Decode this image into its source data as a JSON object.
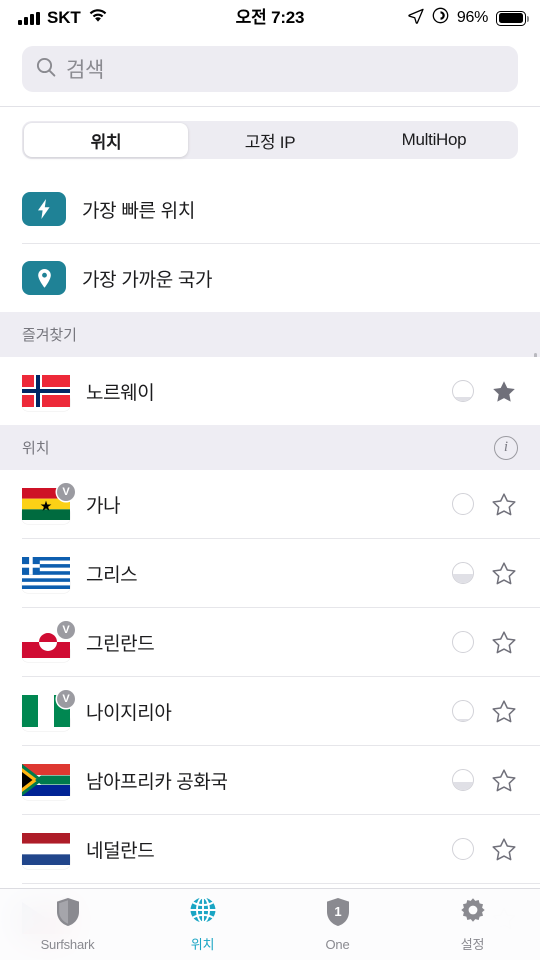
{
  "statusbar": {
    "carrier": "SKT",
    "time": "오전 7:23",
    "battery_percent": "96%",
    "signal_icon": "cellular-bars-icon",
    "wifi_icon": "wifi-icon",
    "location_icon": "location-arrow-icon",
    "vpn_icon": "vpn-badge-icon",
    "battery_icon": "battery-full-icon"
  },
  "search": {
    "placeholder": "검색",
    "icon": "search-icon",
    "value": ""
  },
  "segmented": {
    "options": [
      {
        "label": "위치",
        "selected": true
      },
      {
        "label": "고정 IP",
        "selected": false
      },
      {
        "label": "MultiHop",
        "selected": false
      }
    ]
  },
  "quick_actions": [
    {
      "label": "가장 빠른 위치",
      "icon": "lightning-bolt-icon",
      "color": "#1f8296"
    },
    {
      "label": "가장 가까운 국가",
      "icon": "map-pin-icon",
      "color": "#1f8296"
    }
  ],
  "favorites": {
    "header": "즐겨찾기",
    "items": [
      {
        "name": "노르웨이",
        "flag": "no",
        "virtual": false,
        "favorite": true,
        "load": 22
      }
    ]
  },
  "locations": {
    "header": "위치",
    "info_icon": "info-circle-icon",
    "items": [
      {
        "name": "가나",
        "flag": "gh",
        "virtual": true,
        "favorite": false,
        "load": 0
      },
      {
        "name": "그리스",
        "flag": "gr",
        "virtual": false,
        "favorite": false,
        "load": 45
      },
      {
        "name": "그린란드",
        "flag": "gl",
        "virtual": true,
        "favorite": false,
        "load": 0
      },
      {
        "name": "나이지리아",
        "flag": "ng",
        "virtual": true,
        "favorite": false,
        "load": 8
      },
      {
        "name": "남아프리카 공화국",
        "flag": "za",
        "virtual": false,
        "favorite": false,
        "load": 42
      },
      {
        "name": "네덜란드",
        "flag": "nl",
        "virtual": false,
        "favorite": false,
        "load": 0
      },
      {
        "name": "",
        "flag": "cz",
        "virtual": true,
        "favorite": false,
        "load": 0
      }
    ]
  },
  "tabbar": {
    "items": [
      {
        "label": "Surfshark",
        "icon": "shield-icon",
        "active": false
      },
      {
        "label": "위치",
        "icon": "globe-icon",
        "active": true
      },
      {
        "label": "One",
        "icon": "shield-one-icon",
        "active": false
      },
      {
        "label": "설정",
        "icon": "gear-icon",
        "active": false
      }
    ]
  },
  "colors": {
    "accent": "#1aa5c4",
    "quick_icon": "#1f8296",
    "section_bg": "#eeedf3",
    "search_bg": "#edecf2"
  },
  "virtual_badge_label": "V"
}
